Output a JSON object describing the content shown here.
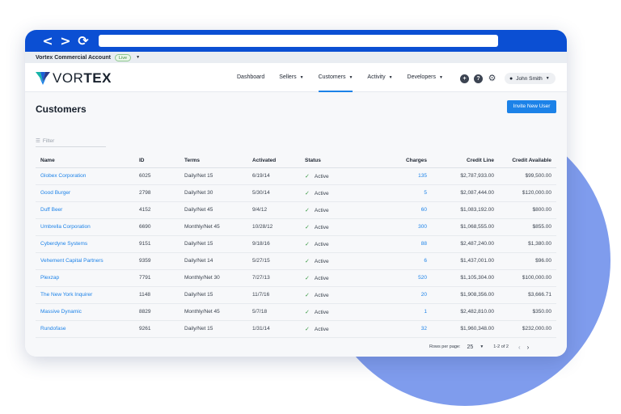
{
  "colors": {
    "chrome": "#0b4fd3",
    "accent": "#1c82e8",
    "circle": "#7f9ced",
    "active_status": "#3c9a45"
  },
  "browser": {
    "back": "<",
    "forward": ">",
    "reload": "⟳"
  },
  "account": {
    "name": "Vortex Commercial Account",
    "badge": "Live"
  },
  "logo": {
    "bold": "VOR",
    "light": "TEX"
  },
  "nav": [
    {
      "label": "Dashboard",
      "dropdown": false
    },
    {
      "label": "Sellers",
      "dropdown": true
    },
    {
      "label": "Customers",
      "dropdown": true,
      "active": true
    },
    {
      "label": "Activity",
      "dropdown": true
    },
    {
      "label": "Developers",
      "dropdown": true
    }
  ],
  "header_icons": {
    "add": "+",
    "help": "?",
    "settings": "⚙"
  },
  "user": {
    "name": "John Smith"
  },
  "page": {
    "title": "Customers",
    "invite_label": "Invite New User"
  },
  "filter": {
    "placeholder": "Filter"
  },
  "table": {
    "columns": [
      "Name",
      "ID",
      "Terms",
      "Activated",
      "Status",
      "Charges",
      "Credit Line",
      "Credit Available"
    ],
    "rows": [
      {
        "name": "Globex Corporation",
        "id": "6025",
        "terms": "Daily/Net 15",
        "activated": "6/19/14",
        "status": "Active",
        "charges": "135",
        "credit_line": "$2,787,933.00",
        "credit_available": "$99,500.00"
      },
      {
        "name": "Good Burger",
        "id": "2798",
        "terms": "Daily/Net 30",
        "activated": "5/30/14",
        "status": "Active",
        "charges": "5",
        "credit_line": "$2,087,444.00",
        "credit_available": "$120,000.00"
      },
      {
        "name": "Duff Beer",
        "id": "4152",
        "terms": "Daily/Net 45",
        "activated": "9/4/12",
        "status": "Active",
        "charges": "60",
        "credit_line": "$1,083,192.00",
        "credit_available": "$800.00"
      },
      {
        "name": "Umbrella Corporation",
        "id": "6690",
        "terms": "Monthly/Net 45",
        "activated": "10/28/12",
        "status": "Active",
        "charges": "300",
        "credit_line": "$1,068,555.00",
        "credit_available": "$855.00"
      },
      {
        "name": "Cyberdyne Systems",
        "id": "9151",
        "terms": "Daily/Net 15",
        "activated": "9/18/16",
        "status": "Active",
        "charges": "88",
        "credit_line": "$2,487,240.00",
        "credit_available": "$1,380.00"
      },
      {
        "name": "Vehement Capital Partners",
        "id": "9359",
        "terms": "Daily/Net 14",
        "activated": "5/27/15",
        "status": "Active",
        "charges": "6",
        "credit_line": "$1,437,001.00",
        "credit_available": "$96.00"
      },
      {
        "name": "Plexzap",
        "id": "7791",
        "terms": "Monthly/Net 30",
        "activated": "7/27/13",
        "status": "Active",
        "charges": "520",
        "credit_line": "$1,105,304.00",
        "credit_available": "$100,000.00"
      },
      {
        "name": "The New York Inquirer",
        "id": "1148",
        "terms": "Daily/Net 15",
        "activated": "11/7/16",
        "status": "Active",
        "charges": "20",
        "credit_line": "$1,908,356.00",
        "credit_available": "$3,666.71"
      },
      {
        "name": "Massive Dynamic",
        "id": "8829",
        "terms": "Monthly/Net 45",
        "activated": "5/7/18",
        "status": "Active",
        "charges": "1",
        "credit_line": "$2,482,810.00",
        "credit_available": "$350.00"
      },
      {
        "name": "Rundofase",
        "id": "9261",
        "terms": "Daily/Net 15",
        "activated": "1/31/14",
        "status": "Active",
        "charges": "32",
        "credit_line": "$1,960,348.00",
        "credit_available": "$232,000.00"
      }
    ]
  },
  "pagination": {
    "rows_per_page_label": "Rows per page:",
    "rows_per_page": "25",
    "range": "1-2 of 2",
    "prev": "‹",
    "next": "›"
  }
}
